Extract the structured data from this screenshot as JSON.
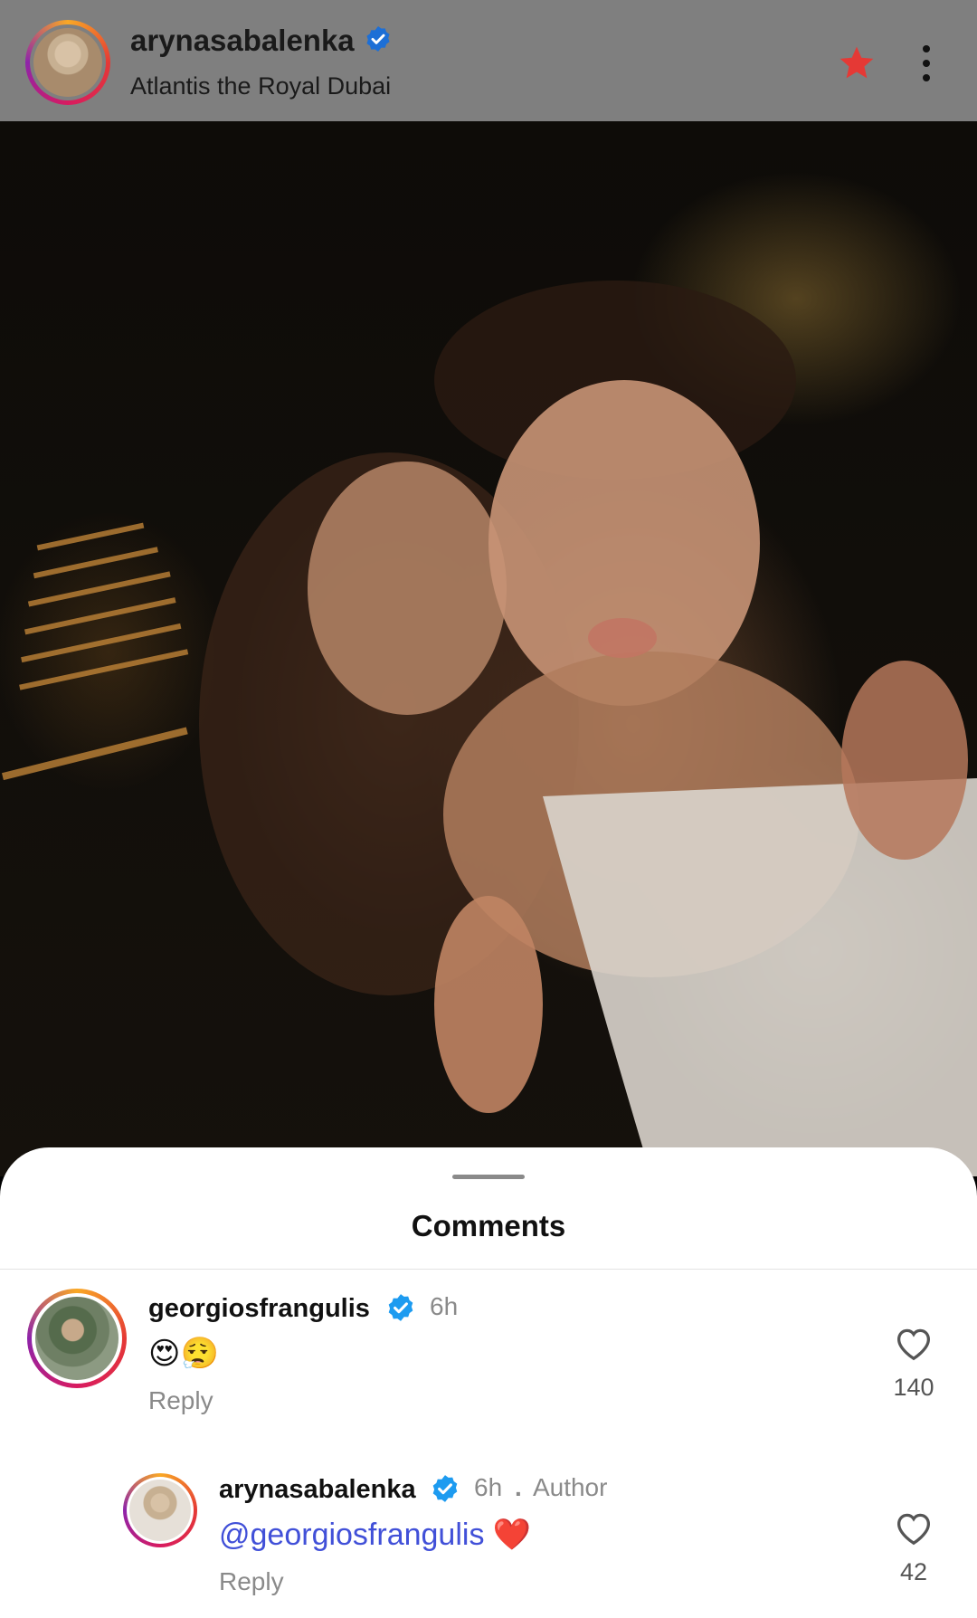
{
  "post": {
    "username": "arynasabalenka",
    "location": "Atlantis the Royal Dubai"
  },
  "sheet": {
    "title": "Comments"
  },
  "comments": [
    {
      "username": "georgiosfrangulis",
      "time": "6h",
      "text": "😍😮‍💨",
      "reply_label": "Reply",
      "likes": "140"
    },
    {
      "username": "arynasabalenka",
      "time": "6h",
      "separator": ".",
      "author_label": "Author",
      "mention": "@georgiosfrangulis",
      "text": "❤️",
      "reply_label": "Reply",
      "likes": "42"
    }
  ],
  "colors": {
    "verified": "#1d9bf0",
    "star": "#e53935",
    "mention": "#4150d8"
  }
}
